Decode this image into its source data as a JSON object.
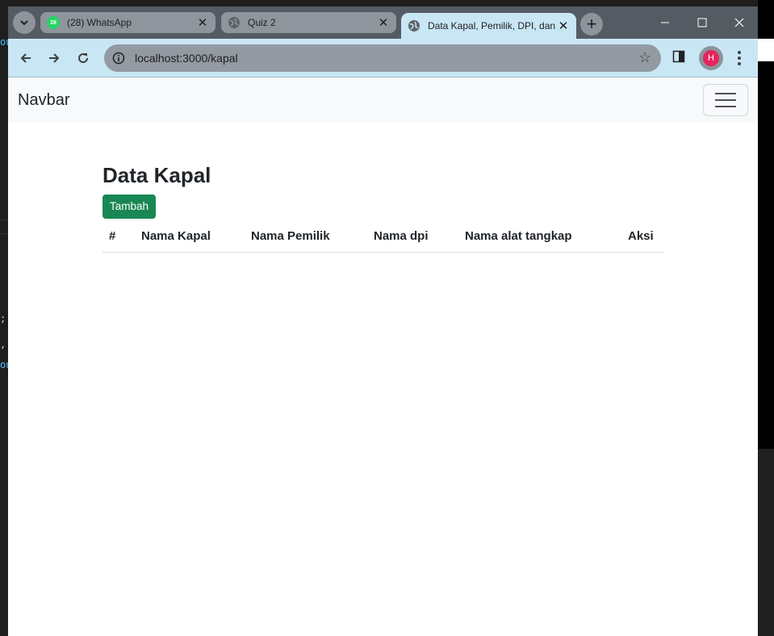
{
  "browser": {
    "tabs": [
      {
        "title": "(28) WhatsApp",
        "badge": "28",
        "active": false
      },
      {
        "title": "Quiz 2",
        "active": false
      },
      {
        "title": "Data Kapal, Pemilik, DPI, dan",
        "active": true
      }
    ],
    "url": "localhost:3000/kapal",
    "profile_initial": "H"
  },
  "navbar": {
    "brand": "Navbar"
  },
  "page": {
    "title": "Data Kapal",
    "add_button": "Tambah",
    "table_headers": [
      "#",
      "Nama Kapal",
      "Nama Pemilik",
      "Nama dpi",
      "Nama alat tangkap",
      "Aksi"
    ]
  },
  "colors": {
    "accent": "#198754",
    "toolbar": "#c9e6f5",
    "tabstrip": "#545b63"
  },
  "background_code_fragments": [
    "ou",
    ";",
    ",",
    "ou"
  ]
}
